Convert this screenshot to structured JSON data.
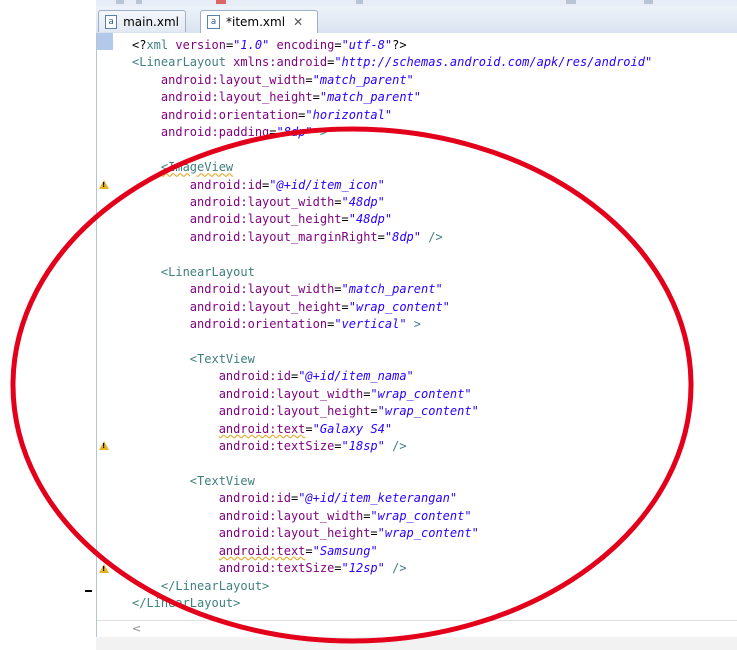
{
  "tabs": [
    {
      "label": "main.xml",
      "icon": "xml-file-icon",
      "active": false
    },
    {
      "label": "*item.xml",
      "icon": "xml-file-icon",
      "active": true,
      "close": "✕"
    }
  ],
  "code_lines": [
    [
      [
        "<?",
        "t-punct"
      ],
      [
        "xml",
        "t-tag"
      ],
      [
        " version",
        "t-attr"
      ],
      [
        "=",
        "t-punct"
      ],
      [
        "\"1.0\"",
        "t-val"
      ],
      [
        " encoding",
        "t-attr"
      ],
      [
        "=",
        "t-punct"
      ],
      [
        "\"utf-8\"",
        "t-val"
      ],
      [
        "?>",
        "t-punct"
      ]
    ],
    [
      [
        "<LinearLayout",
        "t-tag"
      ],
      [
        " xmlns:android",
        "t-attr"
      ],
      [
        "=",
        "t-punct"
      ],
      [
        "\"http://schemas.android.com/apk/res/android\"",
        "t-val"
      ]
    ],
    [
      [
        "    android:layout_width",
        "t-attr"
      ],
      [
        "=",
        "t-punct"
      ],
      [
        "\"match_parent\"",
        "t-val"
      ]
    ],
    [
      [
        "    android:layout_height",
        "t-attr"
      ],
      [
        "=",
        "t-punct"
      ],
      [
        "\"match_parent\"",
        "t-val"
      ]
    ],
    [
      [
        "    android:orientation",
        "t-attr"
      ],
      [
        "=",
        "t-punct"
      ],
      [
        "\"horizontal\"",
        "t-val"
      ]
    ],
    [
      [
        "    android:padding",
        "t-attr"
      ],
      [
        "=",
        "t-punct"
      ],
      [
        "\"8dp\"",
        "t-val"
      ],
      [
        " >",
        "t-tag"
      ]
    ],
    [],
    [
      [
        "    ",
        "t-punct"
      ],
      [
        "<ImageView",
        "t-tag squiggle"
      ]
    ],
    [
      [
        "        android:id",
        "t-attr"
      ],
      [
        "=",
        "t-punct"
      ],
      [
        "\"@+id/item_icon\"",
        "t-val"
      ]
    ],
    [
      [
        "        android:layout_width",
        "t-attr"
      ],
      [
        "=",
        "t-punct"
      ],
      [
        "\"48dp\"",
        "t-val"
      ]
    ],
    [
      [
        "        android:layout_height",
        "t-attr"
      ],
      [
        "=",
        "t-punct"
      ],
      [
        "\"48dp\"",
        "t-val"
      ]
    ],
    [
      [
        "        android:layout_marginRight",
        "t-attr"
      ],
      [
        "=",
        "t-punct"
      ],
      [
        "\"8dp\"",
        "t-val"
      ],
      [
        " />",
        "t-tag"
      ]
    ],
    [],
    [
      [
        "    <LinearLayout",
        "t-tag"
      ]
    ],
    [
      [
        "        android:layout_width",
        "t-attr"
      ],
      [
        "=",
        "t-punct"
      ],
      [
        "\"match_parent\"",
        "t-val"
      ]
    ],
    [
      [
        "        android:layout_height",
        "t-attr"
      ],
      [
        "=",
        "t-punct"
      ],
      [
        "\"wrap_content\"",
        "t-val"
      ]
    ],
    [
      [
        "        android:orientation",
        "t-attr"
      ],
      [
        "=",
        "t-punct"
      ],
      [
        "\"vertical\"",
        "t-val"
      ],
      [
        " >",
        "t-tag"
      ]
    ],
    [],
    [
      [
        "        <TextView",
        "t-tag"
      ]
    ],
    [
      [
        "            android:id",
        "t-attr"
      ],
      [
        "=",
        "t-punct"
      ],
      [
        "\"@+id/item_nama\"",
        "t-val"
      ]
    ],
    [
      [
        "            android:layout_width",
        "t-attr"
      ],
      [
        "=",
        "t-punct"
      ],
      [
        "\"wrap_content\"",
        "t-val"
      ]
    ],
    [
      [
        "            android:layout_height",
        "t-attr"
      ],
      [
        "=",
        "t-punct"
      ],
      [
        "\"wrap_content\"",
        "t-val"
      ]
    ],
    [
      [
        "            ",
        "t-punct"
      ],
      [
        "android:text",
        "t-attr squiggle"
      ],
      [
        "=",
        "t-punct"
      ],
      [
        "\"Galaxy S4\"",
        "t-val"
      ]
    ],
    [
      [
        "            android:textSize",
        "t-attr"
      ],
      [
        "=",
        "t-punct"
      ],
      [
        "\"18sp\"",
        "t-val"
      ],
      [
        " />",
        "t-tag"
      ]
    ],
    [],
    [
      [
        "        <TextView",
        "t-tag"
      ]
    ],
    [
      [
        "            android:id",
        "t-attr"
      ],
      [
        "=",
        "t-punct"
      ],
      [
        "\"@+id/item_keterangan\"",
        "t-val"
      ]
    ],
    [
      [
        "            android:layout_width",
        "t-attr"
      ],
      [
        "=",
        "t-punct"
      ],
      [
        "\"wrap_content\"",
        "t-val"
      ]
    ],
    [
      [
        "            android:layout_height",
        "t-attr"
      ],
      [
        "=",
        "t-punct"
      ],
      [
        "\"wrap_content\"",
        "t-val"
      ]
    ],
    [
      [
        "            ",
        "t-punct"
      ],
      [
        "android:text",
        "t-attr squiggle"
      ],
      [
        "=",
        "t-punct"
      ],
      [
        "\"Samsung\"",
        "t-val"
      ]
    ],
    [
      [
        "            android:textSize",
        "t-attr"
      ],
      [
        "=",
        "t-punct"
      ],
      [
        "\"12sp\"",
        "t-val"
      ],
      [
        " />",
        "t-tag"
      ]
    ],
    [
      [
        "    </LinearLayout>",
        "t-tag"
      ]
    ],
    [
      [
        "</LinearLayout>",
        "t-tag"
      ]
    ]
  ],
  "warning_lines": [
    8,
    23,
    30
  ],
  "colors": {
    "tag": "#3f7f7f",
    "attribute": "#7f007f",
    "value": "#2a00ff",
    "annotation_ellipse": "#e3001b",
    "warning": "#e7b321"
  },
  "scrollbar": {
    "left_arrow": "<"
  }
}
